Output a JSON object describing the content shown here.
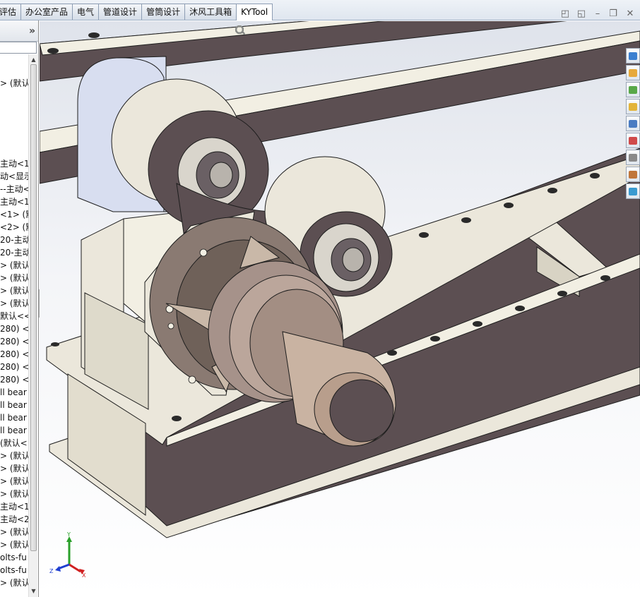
{
  "tabs": [
    {
      "label": "评估",
      "active": false
    },
    {
      "label": "办公室产品",
      "active": false
    },
    {
      "label": "电气",
      "active": false
    },
    {
      "label": "管道设计",
      "active": false
    },
    {
      "label": "管筒设计",
      "active": false
    },
    {
      "label": "沐风工具箱",
      "active": false
    },
    {
      "label": "KYTool",
      "active": true
    }
  ],
  "window_controls": [
    "panel-restore-icon",
    "panel-tile-icon",
    "minimize-icon",
    "restore-icon",
    "close-icon"
  ],
  "sidebar": {
    "collapse_label": "»",
    "tree_items": [
      "> (默认<",
      "主动<1",
      "动<显示",
      "--主动<",
      "主动<1:",
      "<1> (默",
      "<2> (默",
      "20-主动",
      "20-主动",
      "> (默认",
      "> (默认",
      "> (默认",
      "> (默认",
      "默认<<",
      " 280) <",
      " 280) <",
      " 280) <",
      " 280) <",
      " 280) <",
      "ll bear",
      "ll bear",
      "ll bear",
      "ll bear",
      "(默认<",
      "> (默认",
      "> (默认",
      "> (默认",
      "> (默认",
      "主动<1:",
      "主动<2:",
      "> (默认",
      "> (默认",
      "olts-fu",
      "olts-fu",
      "> (默认"
    ]
  },
  "viewport": {
    "heads_up_icons": [
      "zoom-to-fit-icon",
      "zoom-area-icon",
      "previous-view-icon",
      "section-view-icon",
      "view-orientation-icon",
      "display-style-icon",
      "hide-show-items-icon",
      "edit-appearance-icon",
      "apply-scene-icon",
      "view-settings-icon"
    ],
    "triad": {
      "x_label": "X",
      "y_label": "Y",
      "z_label": "Z"
    }
  },
  "taskpane": {
    "icons": [
      {
        "name": "sw-resources-icon",
        "color": "#3a7fd0"
      },
      {
        "name": "home-icon",
        "color": "#e7a93a"
      },
      {
        "name": "design-library-icon",
        "color": "#58a848"
      },
      {
        "name": "file-explorer-icon",
        "color": "#e3b43a"
      },
      {
        "name": "view-palette-icon",
        "color": "#4a7cc2"
      },
      {
        "name": "appearances-icon",
        "color": "#d04a4a"
      },
      {
        "name": "custom-properties-icon",
        "color": "#8a8a8a"
      },
      {
        "name": "toolbox-icon",
        "color": "#c0763a"
      },
      {
        "name": "forum-icon",
        "color": "#3a9ad0"
      }
    ]
  },
  "colors": {
    "model_body": "#5c4f52",
    "model_flange": "#ebe7db",
    "model_light": "#f2efe3",
    "model_edge": "#1d1d1d"
  }
}
